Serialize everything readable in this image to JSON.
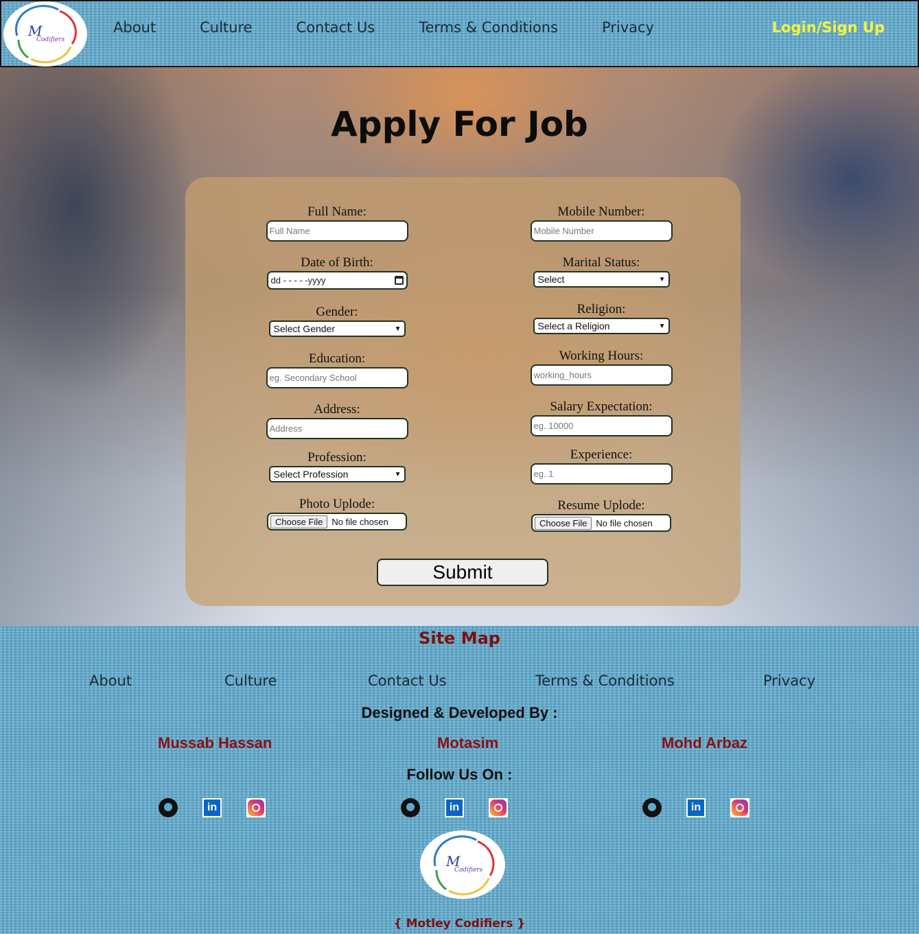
{
  "nav": {
    "links": [
      "About",
      "Culture",
      "Contact Us",
      "Terms & Conditions",
      "Privacy"
    ],
    "login": "Login/Sign Up"
  },
  "logo": {
    "text": "{M Codifiers}"
  },
  "hero": {
    "title": "Apply For Job"
  },
  "form": {
    "full_name": {
      "label": "Full Name:",
      "placeholder": "Full Name"
    },
    "dob": {
      "label": "Date of Birth:",
      "value": "dd - - - - -yyyy"
    },
    "gender": {
      "label": "Gender:",
      "value": "Select Gender"
    },
    "education": {
      "label": "Education:",
      "placeholder": "eg. Secondary School"
    },
    "address": {
      "label": "Address:",
      "placeholder": "Address"
    },
    "profession": {
      "label": "Profession:",
      "value": "Select Profession"
    },
    "photo": {
      "label": "Photo Uplode:",
      "button": "Choose File",
      "status": "No file chosen"
    },
    "mobile": {
      "label": "Mobile Number:",
      "placeholder": "Mobile Number"
    },
    "marital": {
      "label": "Marital Status:",
      "value": "Select"
    },
    "religion": {
      "label": "Religion:",
      "value": "Select a Religion"
    },
    "hours": {
      "label": "Working Hours:",
      "placeholder": "working_hours"
    },
    "salary": {
      "label": "Salary Expectation:",
      "placeholder": "eg. 10000"
    },
    "experience": {
      "label": "Experience:",
      "placeholder": "eg. 1"
    },
    "resume": {
      "label": "Resume Uplode:",
      "button": "Choose File",
      "status": "No file chosen"
    },
    "submit": "Submit"
  },
  "footer": {
    "sitemap_title": "Site Map",
    "links": [
      "About",
      "Culture",
      "Contact Us",
      "Terms & Conditions",
      "Privacy"
    ],
    "designed_by": "Designed & Developed By :",
    "developers": [
      "Mussab Hassan",
      "Motasim",
      "Mohd Arbaz"
    ],
    "follow": "Follow Us On :",
    "icons": [
      "github-icon",
      "linkedin-icon",
      "instagram-icon"
    ],
    "linkedin_glyph": "in",
    "brand": "{ Motley Codifiers }"
  },
  "colors": {
    "nav_bg": "#5ea9cc",
    "login": "#f4f43c",
    "accent_red": "#8b1010",
    "card": "#c8a06e"
  }
}
